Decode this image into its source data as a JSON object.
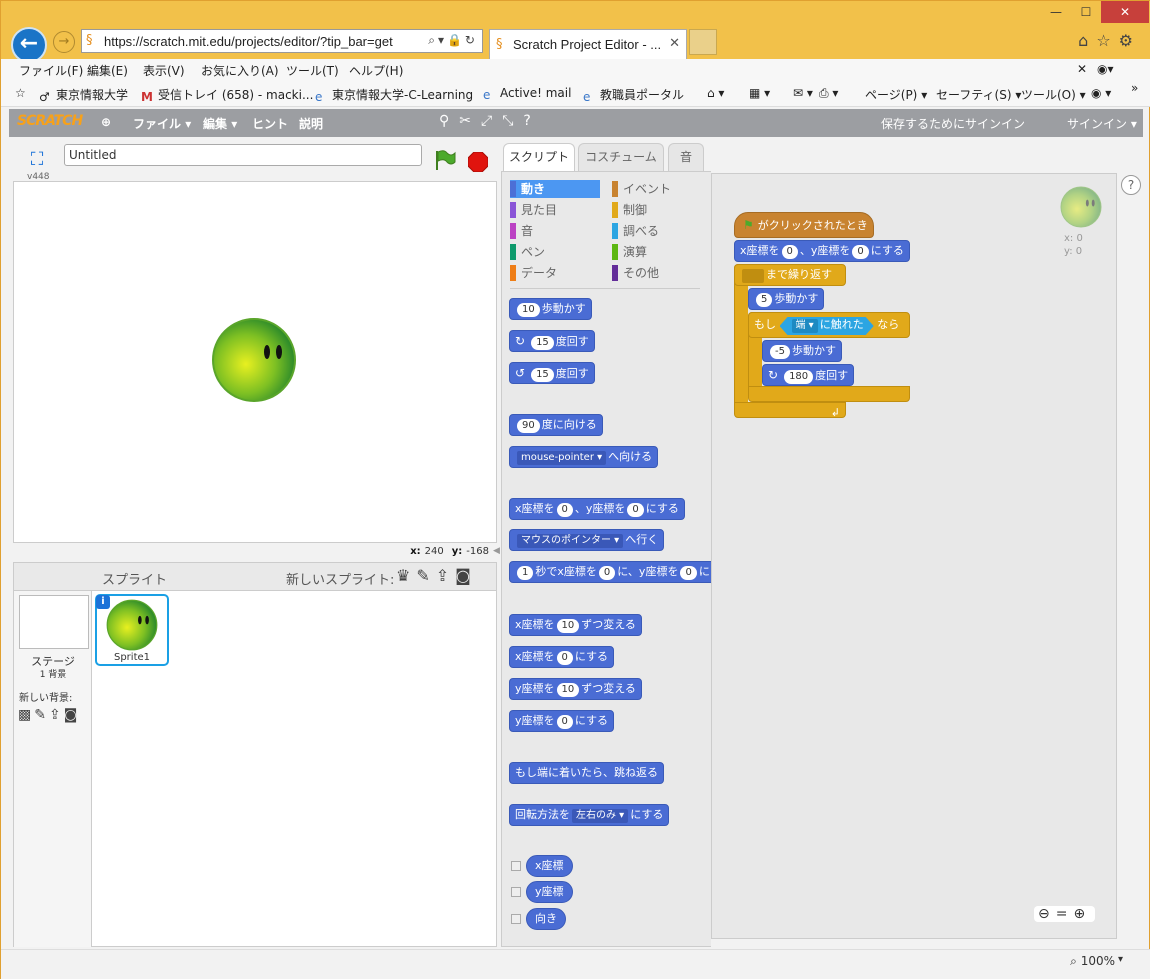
{
  "browser": {
    "url": "https://scratch.mit.edu/projects/editor/?tip_bar=get",
    "tab_title": "Scratch Project Editor - ...",
    "menu": [
      "ファイル(F)",
      "編集(E)",
      "表示(V)",
      "お気に入り(A)",
      "ツール(T)",
      "ヘルプ(H)"
    ],
    "favorites": [
      "東京情報大学",
      "受信トレイ (658) - macki...",
      "東京情報大学-C-Learning",
      "Active! mail",
      "教職員ポータル"
    ],
    "toolbar_right": [
      "ページ(P)",
      "セーフティ(S)",
      "ツール(O)"
    ],
    "zoom": "100%"
  },
  "scratch": {
    "logo": "SCRATCH",
    "menu": [
      "ファイル",
      "編集",
      "ヒント",
      "説明"
    ],
    "save_prompt": "保存するためにサインイン",
    "sign_in": "サインイン",
    "project_title": "Untitled",
    "version": "v448",
    "mouse_x": "240",
    "mouse_y": "-168",
    "sprites_label": "スプライト",
    "new_sprite_label": "新しいスプライト:",
    "stage_label": "ステージ",
    "stage_backdrop_count": "1 背景",
    "new_backdrop_label": "新しい背景:",
    "sprite_name": "Sprite1",
    "tabs": [
      "スクリプト",
      "コスチューム",
      "音"
    ],
    "categories_left": [
      "動き",
      "見た目",
      "音",
      "ペン",
      "データ"
    ],
    "categories_right": [
      "イベント",
      "制御",
      "調べる",
      "演算",
      "その他"
    ],
    "palette": {
      "move": "歩動かす",
      "move_val": "10",
      "turn_r": "度回す",
      "turn_r_val": "15",
      "turn_l": "度回す",
      "turn_l_val": "15",
      "point_dir": "度に向ける",
      "point_dir_val": "90",
      "point_towards_sel": "mouse-pointer",
      "point_towards": "へ向ける",
      "goto_xy_a": "x座標を",
      "goto_xy_x": "0",
      "goto_xy_b": "、y座標を",
      "goto_xy_y": "0",
      "goto_xy_c": "にする",
      "goto_sel": "マウスのポインター",
      "goto": "へ行く",
      "glide_sec": "1",
      "glide_a": "秒でx座標を",
      "glide_x": "0",
      "glide_b": "に、y座標を",
      "glide_y": "0",
      "glide_c": "に",
      "change_x_a": "x座標を",
      "change_x_val": "10",
      "change_x_b": "ずつ変える",
      "set_x_a": "x座標を",
      "set_x_val": "0",
      "set_x_b": "にする",
      "change_y_a": "y座標を",
      "change_y_val": "10",
      "change_y_b": "ずつ変える",
      "set_y_a": "y座標を",
      "set_y_val": "0",
      "set_y_b": "にする",
      "bounce": "もし端に着いたら、跳ね返る",
      "rotation_a": "回転方法を",
      "rotation_sel": "左右のみ",
      "rotation_b": "にする",
      "rep_x": "x座標",
      "rep_y": "y座標",
      "rep_dir": "向き"
    },
    "script": {
      "hat": "がクリックされたとき",
      "goto_a": "x座標を",
      "goto_x": "0",
      "goto_b": "、y座標を",
      "goto_y": "0",
      "goto_c": "にする",
      "repeat_until": "まで繰り返す",
      "move_val": "5",
      "move": "歩動かす",
      "if": "もし",
      "touching_sel": "端",
      "touching": "に触れた",
      "then": "なら",
      "move2_val": "-5",
      "move2": "歩動かす",
      "turn_val": "180",
      "turn": "度回す"
    },
    "sa_x": "x: 0",
    "sa_y": "y: 0",
    "colors": {
      "motion": "#4a6cd4",
      "events": "#c88330",
      "control": "#e1a91a",
      "sensing": "#2ca5e2"
    }
  }
}
